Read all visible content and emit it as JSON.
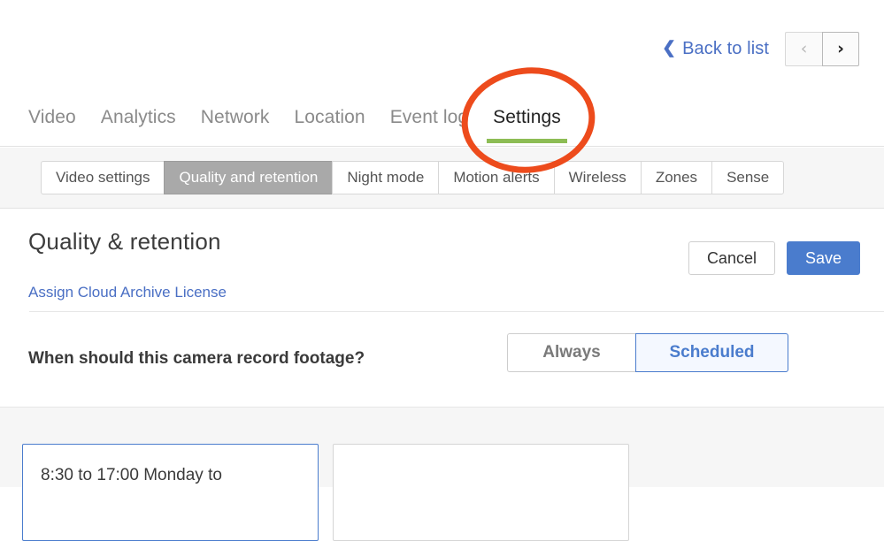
{
  "header": {
    "back_label": "Back to list",
    "back_icon": "chevron-left-icon",
    "prev_icon": "‹",
    "next_icon": "›"
  },
  "main_tabs": [
    {
      "label": "Video",
      "active": false
    },
    {
      "label": "Analytics",
      "active": false
    },
    {
      "label": "Network",
      "active": false
    },
    {
      "label": "Location",
      "active": false
    },
    {
      "label": "Event log",
      "active": false
    },
    {
      "label": "Settings",
      "active": true
    }
  ],
  "sub_tabs": [
    {
      "label": "Video settings",
      "active": false
    },
    {
      "label": "Quality and retention",
      "active": true
    },
    {
      "label": "Night mode",
      "active": false
    },
    {
      "label": "Motion alerts",
      "active": false
    },
    {
      "label": "Wireless",
      "active": false
    },
    {
      "label": "Zones",
      "active": false
    },
    {
      "label": "Sense",
      "active": false
    }
  ],
  "page": {
    "title": "Quality & retention",
    "license_link": "Assign Cloud Archive License",
    "cancel_label": "Cancel",
    "save_label": "Save"
  },
  "record_setting": {
    "question": "When should this camera record footage?",
    "option_always": "Always",
    "option_scheduled": "Scheduled",
    "selected": "Scheduled"
  },
  "schedule_cards": [
    {
      "text": "8:30 to 17:00 Monday to",
      "selected": true
    },
    {
      "text": "",
      "selected": false
    }
  ],
  "annotation": {
    "shape": "ellipse-highlight",
    "target": "Settings",
    "color": "#ED4B1C"
  },
  "colors": {
    "accent_blue": "#4a7ccd",
    "link_blue": "#4a6fc4",
    "active_tab_green": "#8dbd55",
    "annotation_orange": "#ED4B1C",
    "subtab_active_gray": "#a9a9a9"
  }
}
